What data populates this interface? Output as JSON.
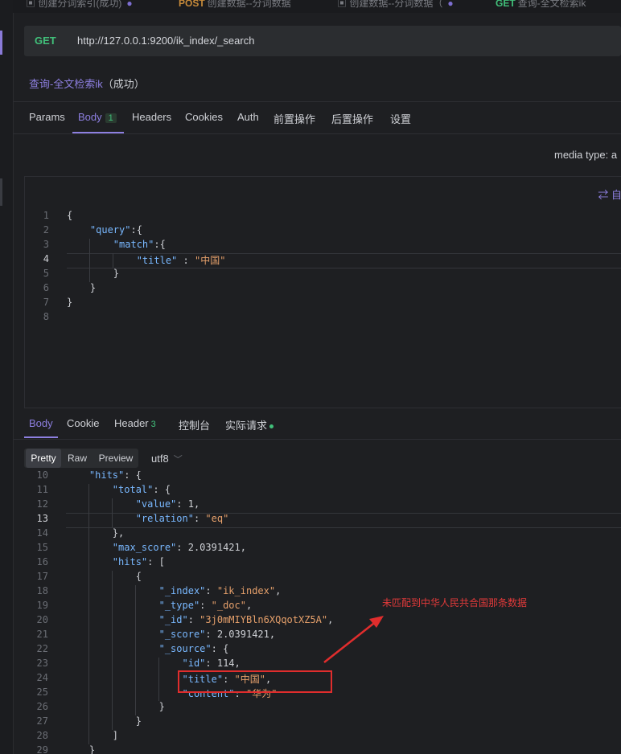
{
  "top_tabs": [
    {
      "method": "",
      "label": "创建分词索引(成功)"
    },
    {
      "method": "POST",
      "label": "创建数据--分词数据"
    },
    {
      "method": "",
      "label": "创建数据--分词数据（"
    },
    {
      "method": "GET",
      "label": "查询-全文检索ik"
    }
  ],
  "request": {
    "method": "GET",
    "url": "http://127.0.0.1:9200/ik_index/_search",
    "name": "查询-全文检索ik",
    "status": "（成功）"
  },
  "req_tabs": [
    {
      "label": "Params"
    },
    {
      "label": "Body",
      "badge": "1"
    },
    {
      "label": "Headers"
    },
    {
      "label": "Cookies"
    },
    {
      "label": "Auth"
    },
    {
      "label": "前置操作"
    },
    {
      "label": "后置操作"
    },
    {
      "label": "设置"
    }
  ],
  "media_type": "media type: a",
  "auto_format": "⇄ 自",
  "request_body": {
    "line_numbers": [
      "1",
      "2",
      "3",
      "4",
      "5",
      "6",
      "7",
      "8"
    ],
    "current_line": "4",
    "lines": [
      [
        {
          "c": "n",
          "t": "{"
        }
      ],
      [
        {
          "c": "n",
          "t": "    "
        },
        {
          "c": "k",
          "t": "\"query\""
        },
        {
          "c": "n",
          "t": ":{"
        }
      ],
      [
        {
          "c": "n",
          "t": "        "
        },
        {
          "c": "k",
          "t": "\"match\""
        },
        {
          "c": "n",
          "t": ":{"
        }
      ],
      [
        {
          "c": "n",
          "t": "            "
        },
        {
          "c": "k",
          "t": "\"title\""
        },
        {
          "c": "n",
          "t": " : "
        },
        {
          "c": "s",
          "t": "\"中国\""
        }
      ],
      [
        {
          "c": "n",
          "t": "        }"
        }
      ],
      [
        {
          "c": "n",
          "t": "    }"
        }
      ],
      [
        {
          "c": "n",
          "t": "}"
        }
      ],
      [
        {
          "c": "n",
          "t": ""
        }
      ]
    ]
  },
  "resp_tabs": [
    {
      "label": "Body"
    },
    {
      "label": "Cookie"
    },
    {
      "label": "Header",
      "badge": "3"
    },
    {
      "label": "控制台"
    },
    {
      "label": "实际请求",
      "dot": true
    }
  ],
  "format_buttons": [
    "Pretty",
    "Raw",
    "Preview"
  ],
  "encoding": "utf8",
  "response_body": {
    "line_numbers": [
      "10",
      "11",
      "12",
      "13",
      "14",
      "15",
      "16",
      "17",
      "18",
      "19",
      "20",
      "21",
      "22",
      "23",
      "24",
      "25",
      "26",
      "27",
      "28",
      "29"
    ],
    "current_line": "13",
    "lines": [
      [
        {
          "c": "n",
          "t": "    "
        },
        {
          "c": "k",
          "t": "\"hits\""
        },
        {
          "c": "n",
          "t": ": {"
        }
      ],
      [
        {
          "c": "n",
          "t": "        "
        },
        {
          "c": "k",
          "t": "\"total\""
        },
        {
          "c": "n",
          "t": ": {"
        }
      ],
      [
        {
          "c": "n",
          "t": "            "
        },
        {
          "c": "k",
          "t": "\"value\""
        },
        {
          "c": "n",
          "t": ": 1,"
        }
      ],
      [
        {
          "c": "n",
          "t": "            "
        },
        {
          "c": "k",
          "t": "\"relation\""
        },
        {
          "c": "n",
          "t": ": "
        },
        {
          "c": "s",
          "t": "\"eq\""
        }
      ],
      [
        {
          "c": "n",
          "t": "        },"
        }
      ],
      [
        {
          "c": "n",
          "t": "        "
        },
        {
          "c": "k",
          "t": "\"max_score\""
        },
        {
          "c": "n",
          "t": ": 2.0391421,"
        }
      ],
      [
        {
          "c": "n",
          "t": "        "
        },
        {
          "c": "k",
          "t": "\"hits\""
        },
        {
          "c": "n",
          "t": ": ["
        }
      ],
      [
        {
          "c": "n",
          "t": "            {"
        }
      ],
      [
        {
          "c": "n",
          "t": "                "
        },
        {
          "c": "k",
          "t": "\"_index\""
        },
        {
          "c": "n",
          "t": ": "
        },
        {
          "c": "s",
          "t": "\"ik_index\""
        },
        {
          "c": "n",
          "t": ","
        }
      ],
      [
        {
          "c": "n",
          "t": "                "
        },
        {
          "c": "k",
          "t": "\"_type\""
        },
        {
          "c": "n",
          "t": ": "
        },
        {
          "c": "s",
          "t": "\"_doc\""
        },
        {
          "c": "n",
          "t": ","
        }
      ],
      [
        {
          "c": "n",
          "t": "                "
        },
        {
          "c": "k",
          "t": "\"_id\""
        },
        {
          "c": "n",
          "t": ": "
        },
        {
          "c": "s",
          "t": "\"3j0mMIYBln6XQqotXZ5A\""
        },
        {
          "c": "n",
          "t": ","
        }
      ],
      [
        {
          "c": "n",
          "t": "                "
        },
        {
          "c": "k",
          "t": "\"_score\""
        },
        {
          "c": "n",
          "t": ": 2.0391421,"
        }
      ],
      [
        {
          "c": "n",
          "t": "                "
        },
        {
          "c": "k",
          "t": "\"_source\""
        },
        {
          "c": "n",
          "t": ": {"
        }
      ],
      [
        {
          "c": "n",
          "t": "                    "
        },
        {
          "c": "k",
          "t": "\"id\""
        },
        {
          "c": "n",
          "t": ": 114,"
        }
      ],
      [
        {
          "c": "n",
          "t": "                    "
        },
        {
          "c": "k",
          "t": "\"title\""
        },
        {
          "c": "n",
          "t": ": "
        },
        {
          "c": "s",
          "t": "\"中国\""
        },
        {
          "c": "n",
          "t": ","
        }
      ],
      [
        {
          "c": "n",
          "t": "                    "
        },
        {
          "c": "k",
          "t": "\"content\""
        },
        {
          "c": "n",
          "t": ": "
        },
        {
          "c": "s",
          "t": "\"华为\""
        }
      ],
      [
        {
          "c": "n",
          "t": "                }"
        }
      ],
      [
        {
          "c": "n",
          "t": "            }"
        }
      ],
      [
        {
          "c": "n",
          "t": "        ]"
        }
      ],
      [
        {
          "c": "n",
          "t": "    }"
        }
      ]
    ]
  },
  "annotation": {
    "text": "未匹配到中华人民共合国那条数据",
    "color": "#e23a3a"
  },
  "colors": {
    "accent": "#8d7fe0",
    "get_method": "#41c07a",
    "json_key": "#79b8ff",
    "json_string": "#e6a06b",
    "highlight_box": "#e02d2d"
  }
}
